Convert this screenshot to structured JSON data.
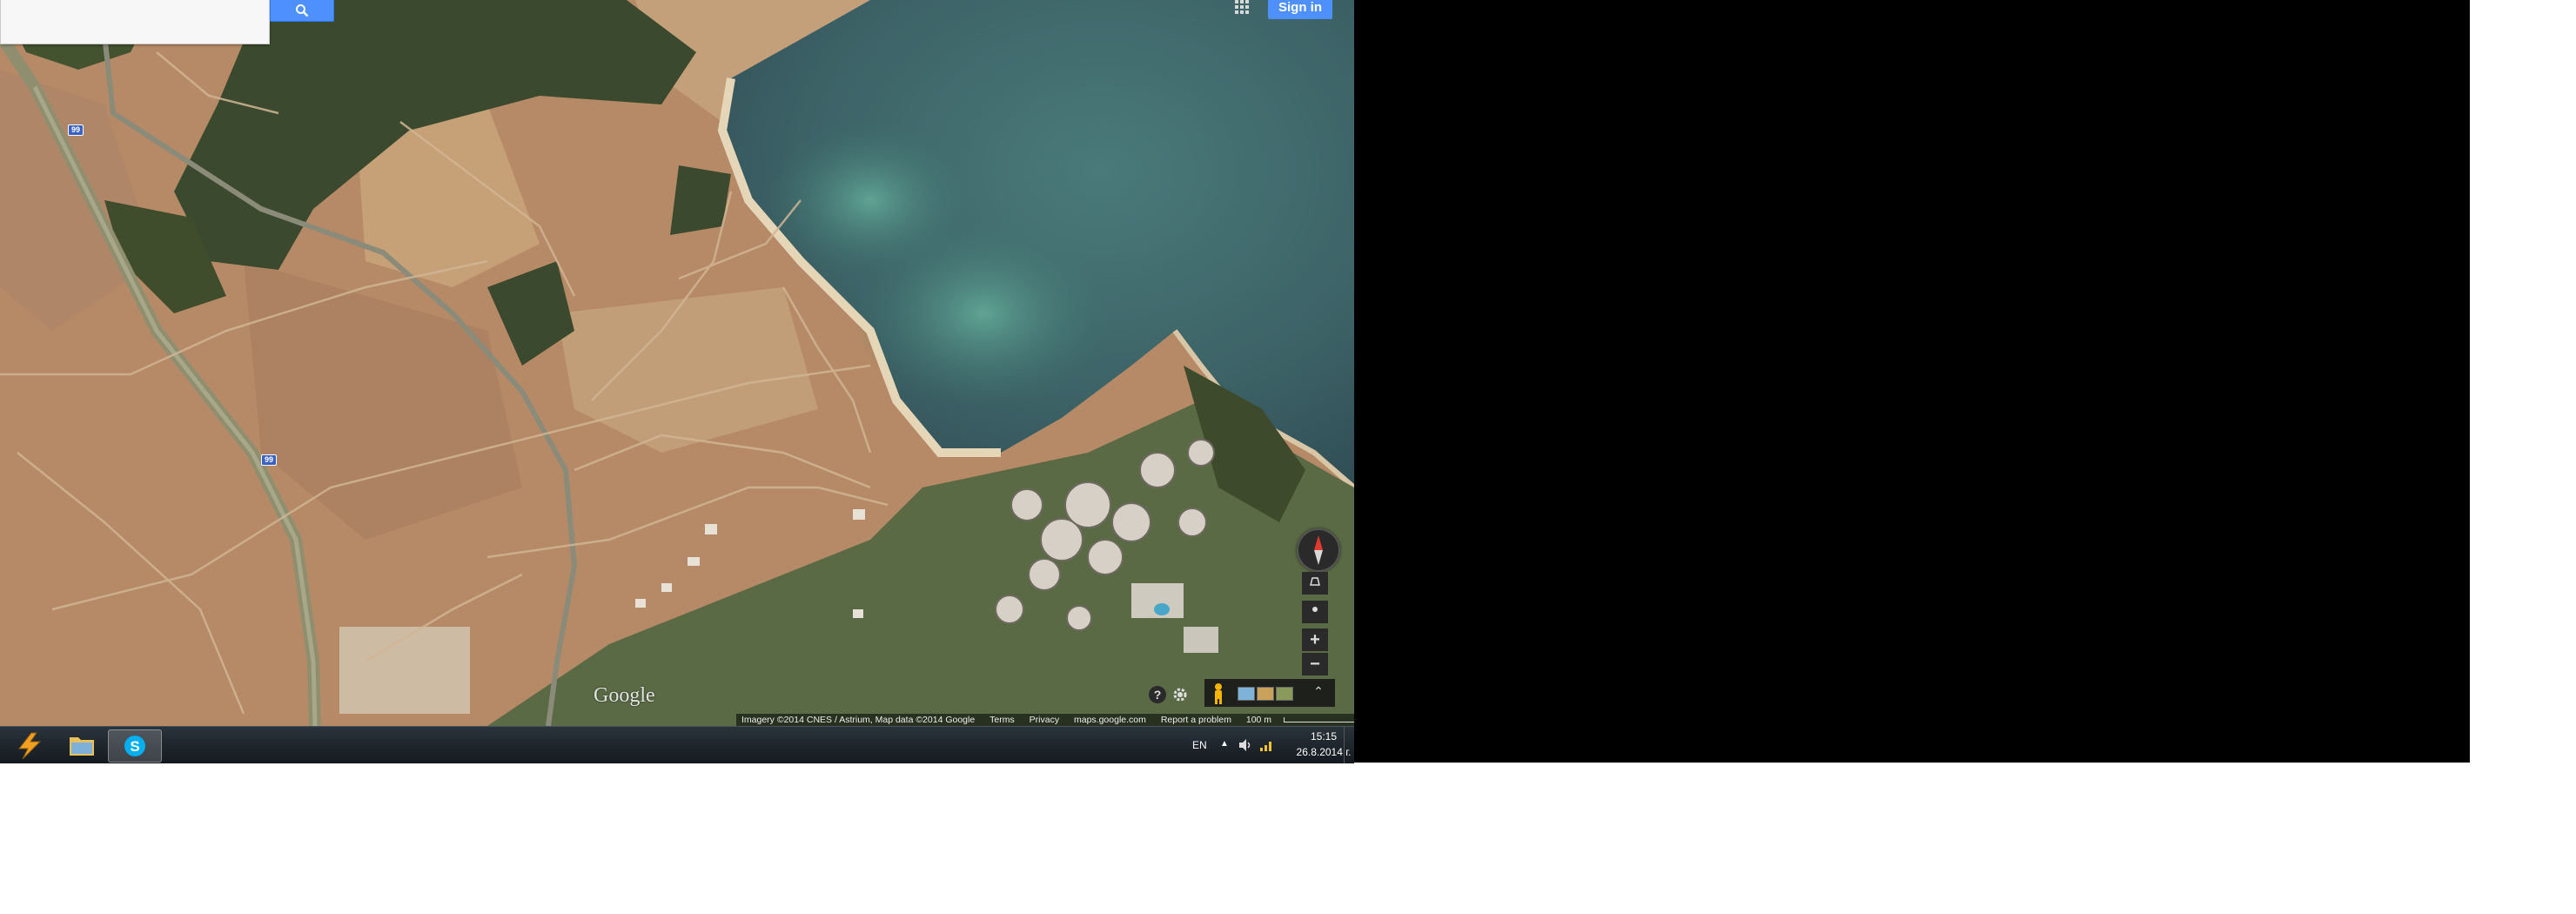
{
  "top": {
    "search_placeholder": "",
    "signin_label": "Sign in"
  },
  "map": {
    "road_labels": [
      "99",
      "99"
    ],
    "logo": "Google",
    "footer": {
      "imagery": "Imagery ©2014 CNES / Astrium, Map data ©2014 Google",
      "terms": "Terms",
      "privacy": "Privacy",
      "site": "maps.google.com",
      "report": "Report a problem",
      "scale": "100 m"
    },
    "controls": {
      "zoom_in": "+",
      "zoom_out": "−",
      "help": "?"
    },
    "colors": {
      "sea": "#3f6b6e",
      "land": "#b68a66",
      "forest": "#3b4a2e"
    }
  },
  "taskbar": {
    "language": "EN",
    "time": "15:15",
    "date": "26.8.2014 г."
  }
}
